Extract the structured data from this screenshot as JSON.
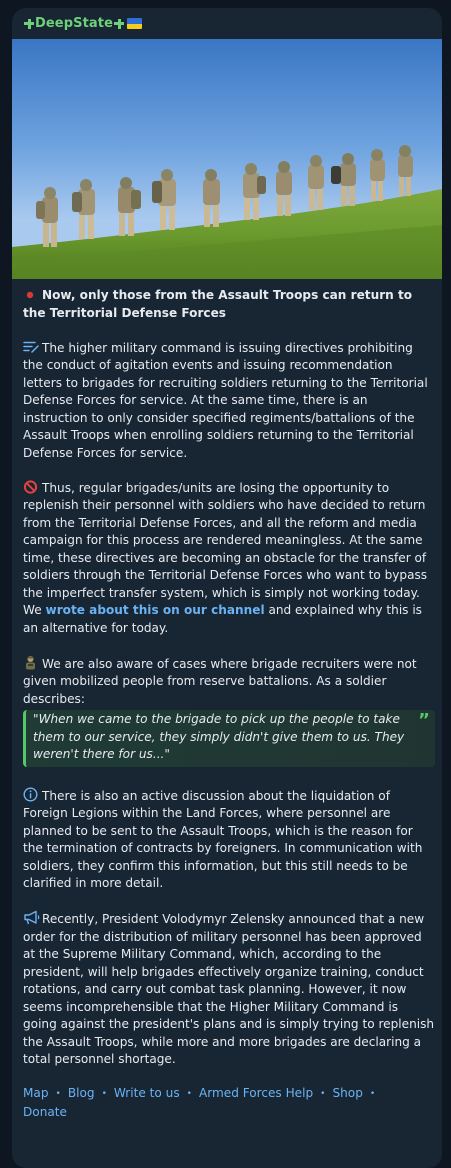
{
  "channel": {
    "name": "DeepState",
    "flag_icon": "ukraine-flag-icon",
    "cross_icon": "green-cross-icon"
  },
  "photo": {
    "icon": "soldiers-photo"
  },
  "post": {
    "headline": {
      "icon": "red-dot-icon",
      "text": "Now, only those from the Assault Troops can return to the Territorial Defense Forces"
    },
    "p1": {
      "icon": "memo-icon",
      "text": "The higher military command is issuing directives prohibiting the conduct of agitation events and issuing recommendation letters to brigades for recruiting soldiers returning to the Territorial Defense Forces for service. At the same time, there is an instruction to only consider specified regiments/battalions of the Assault Troops when enrolling soldiers returning to the Territorial Defense Forces for service."
    },
    "p2": {
      "icon": "prohibited-icon",
      "text_before": "Thus, regular brigades/units are losing the opportunity to replenish their personnel with soldiers who have decided to return from the Territorial Defense Forces, and all the reform and media campaign for this process are rendered meaningless. At the same time, these directives are becoming an obstacle for the transfer of soldiers through the Territorial Defense Forces who want to bypass the imperfect transfer system, which is simply not working today. We ",
      "link": "wrote about this on our channel",
      "text_after": " and explained why this is an alternative for today."
    },
    "p3": {
      "icon": "soldier-icon",
      "text": "We are also aware of cases where brigade recruiters were not given mobilized people from reserve battalions. As a soldier describes:"
    },
    "quote": {
      "text": "\"When we came to the brigade to pick up the people to take them to our service, they simply didn't give them to us. They weren't there for us...\"",
      "mark": "”"
    },
    "p4": {
      "icon": "info-icon",
      "text": "There is also an active discussion about the liquidation of Foreign Legions within the Land Forces, where personnel are planned to be sent to the Assault Troops, which is the reason for the termination of contracts by foreigners. In communication with soldiers, they confirm this information, but this still needs to be clarified in more detail."
    },
    "p5": {
      "icon": "megaphone-icon",
      "text": "Recently, President Volodymyr Zelensky announced that a new order for the distribution of military personnel has been approved at the Supreme Military Command, which, according to the president, will help brigades effectively organize training, conduct rotations, and carry out combat task planning. However, it now seems incomprehensible that the Higher Military Command is going against the president's plans and is simply trying to replenish the Assault Troops, while more and more brigades are declaring a total personnel shortage."
    }
  },
  "footer": {
    "links": [
      "Map",
      "Blog",
      "Write to us",
      "Armed Forces Help",
      "Shop",
      "Donate"
    ],
    "separator": "•"
  },
  "colors": {
    "background": "#0e1621",
    "bubble": "#182533",
    "accent_link": "#6ab3f3",
    "channel_green": "#6fd07a",
    "quote_bar": "#56c764"
  }
}
